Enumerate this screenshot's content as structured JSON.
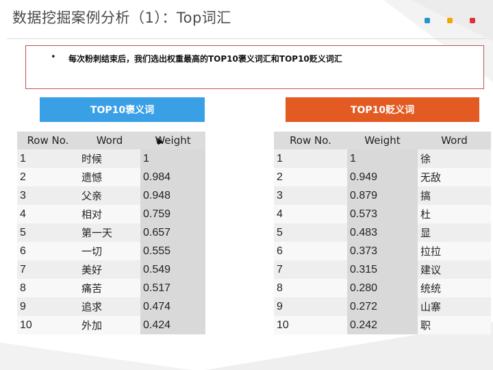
{
  "slide": {
    "title": "数据挖掘案例分析（1）：Top词汇",
    "bullet": "每次粉刺结束后，我们选出权重最高的TOP10褒义词汇和TOP10贬义词汇",
    "accent_colors": [
      "#2196c9",
      "#f0a800",
      "#e0303f"
    ]
  },
  "positive": {
    "header": "TOP10褒义词",
    "header_color": "#3aa0e6",
    "columns": [
      "Row No.",
      "Word",
      "Weight"
    ],
    "rows": [
      [
        "1",
        "时候",
        "1"
      ],
      [
        "2",
        "遗憾",
        "0.984"
      ],
      [
        "3",
        "父亲",
        "0.948"
      ],
      [
        "4",
        "相对",
        "0.759"
      ],
      [
        "5",
        "第一天",
        "0.657"
      ],
      [
        "6",
        "一切",
        "0.555"
      ],
      [
        "7",
        "美好",
        "0.549"
      ],
      [
        "8",
        "痛苦",
        "0.517"
      ],
      [
        "9",
        "追求",
        "0.474"
      ],
      [
        "10",
        "外加",
        "0.424"
      ]
    ]
  },
  "negative": {
    "header": "TOP10贬义词",
    "header_color": "#e35a22",
    "columns": [
      "Row No.",
      "Weight",
      "Word"
    ],
    "rows": [
      [
        "1",
        "1",
        "徐"
      ],
      [
        "2",
        "0.949",
        "无敌"
      ],
      [
        "3",
        "0.879",
        "搞"
      ],
      [
        "4",
        "0.573",
        "杜"
      ],
      [
        "5",
        "0.483",
        "显"
      ],
      [
        "6",
        "0.373",
        "拉拉"
      ],
      [
        "7",
        "0.315",
        "建议"
      ],
      [
        "8",
        "0.280",
        "统统"
      ],
      [
        "9",
        "0.272",
        "山寨"
      ],
      [
        "10",
        "0.242",
        "职"
      ]
    ]
  }
}
